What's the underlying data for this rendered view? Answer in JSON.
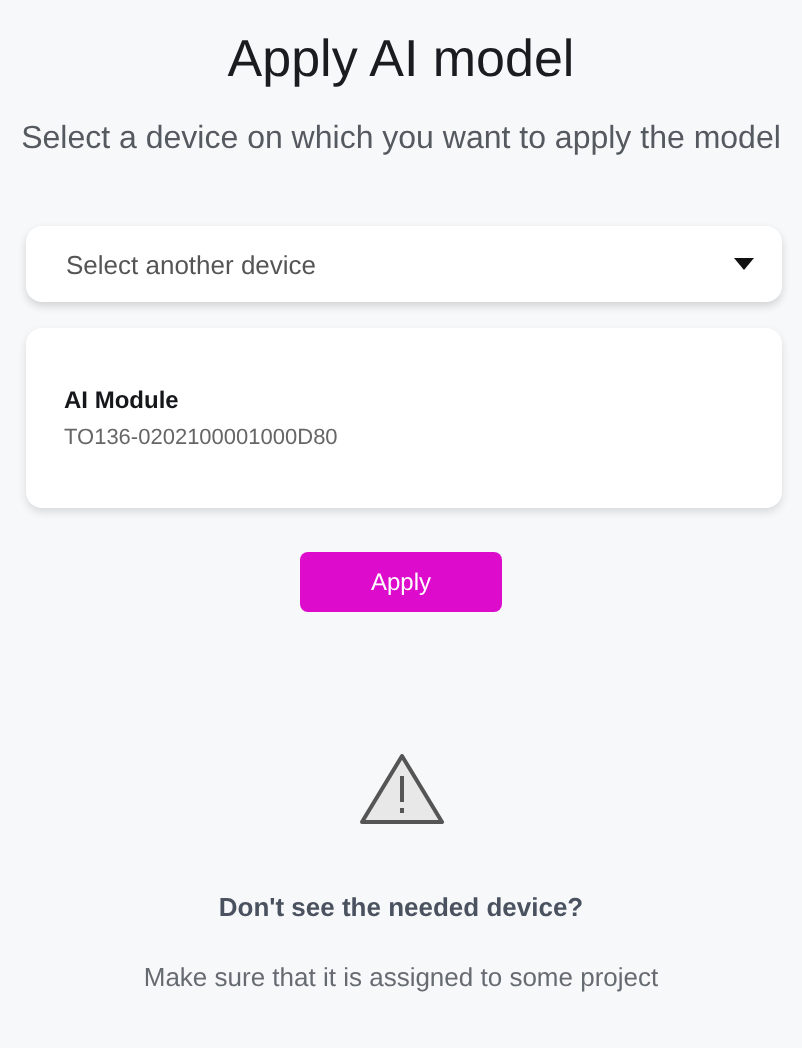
{
  "title": "Apply AI model",
  "subtitle": "Select a device on which you want to apply the model",
  "device_select": {
    "placeholder": "Select another device"
  },
  "devices": [
    {
      "name": "AI Module",
      "serial": "TO136-0202100001000D80"
    }
  ],
  "apply_button": "Apply",
  "notice": {
    "heading": "Don't see the needed device?",
    "text": "Make sure that it is assigned to some project"
  }
}
